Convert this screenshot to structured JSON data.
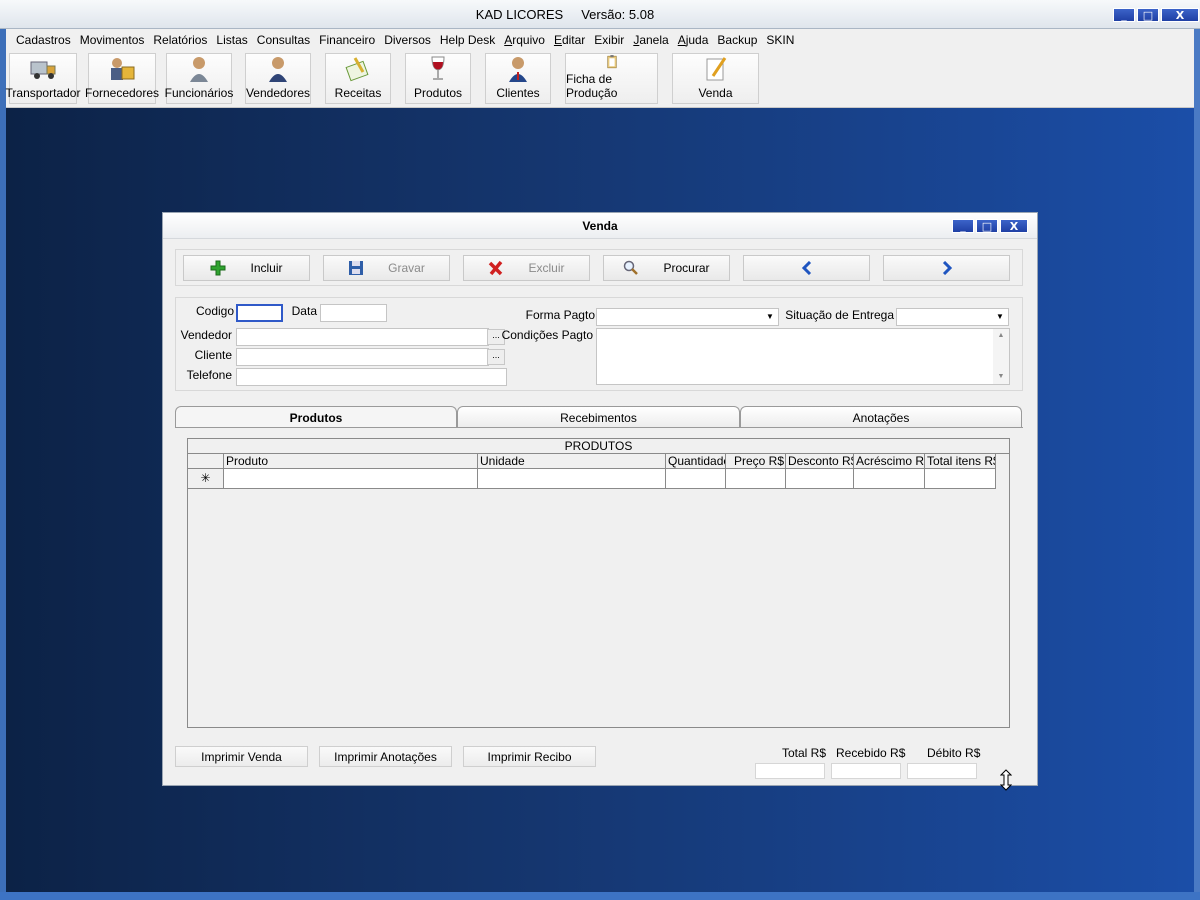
{
  "app": {
    "title": "KAD LICORES",
    "version": "Versão: 5.08",
    "window_controls": [
      "_",
      "□",
      "X"
    ]
  },
  "menu": [
    {
      "label": "Cadastros"
    },
    {
      "label": "Movimentos"
    },
    {
      "label": "Relatórios"
    },
    {
      "label": "Listas"
    },
    {
      "label": "Consultas"
    },
    {
      "label": "Financeiro"
    },
    {
      "label": "Diversos"
    },
    {
      "label": "Help Desk"
    },
    {
      "label": "Arquivo"
    },
    {
      "label": "Editar"
    },
    {
      "label": "Exibir"
    },
    {
      "label": "Janela"
    },
    {
      "label": "Ajuda"
    },
    {
      "label": "Backup"
    },
    {
      "label": "SKIN"
    }
  ],
  "toolbar": [
    {
      "label": "Transportador",
      "icon": "truck-icon"
    },
    {
      "label": "Fornecedores",
      "icon": "suppliers-icon"
    },
    {
      "label": "Funcionários",
      "icon": "employee-icon"
    },
    {
      "label": "Vendedores",
      "icon": "seller-icon"
    },
    {
      "label": "Receitas",
      "icon": "recipe-icon"
    },
    {
      "label": "Produtos",
      "icon": "wine-glass-icon"
    },
    {
      "label": "Clientes",
      "icon": "client-icon"
    },
    {
      "label": "Ficha de Produção",
      "icon": "clipboard-icon"
    },
    {
      "label": "Venda",
      "icon": "notepad-pencil-icon"
    }
  ],
  "venda": {
    "title": "Venda",
    "actions": {
      "incluir": "Incluir",
      "gravar": "Gravar",
      "excluir": "Excluir",
      "procurar": "Procurar",
      "prev": "‹",
      "next": "›"
    },
    "form": {
      "codigo_label": "Codigo",
      "codigo_value": "",
      "data_label": "Data",
      "data_value": "",
      "vendedor_label": "Vendedor",
      "cliente_label": "Cliente",
      "telefone_label": "Telefone",
      "forma_pagto_label": "Forma Pagto",
      "forma_pagto_value": "",
      "situacao_label": "Situação de Entrega",
      "situacao_value": "",
      "condicoes_label": "Condições Pagto",
      "ellipsis": "..."
    },
    "tabs": [
      {
        "label": "Produtos",
        "active": true
      },
      {
        "label": "Recebimentos",
        "active": false
      },
      {
        "label": "Anotações",
        "active": false
      }
    ],
    "grid": {
      "caption": "PRODUTOS",
      "columns": [
        "Produto",
        "Unidade",
        "Quantidade",
        "Preço R$",
        "Desconto R$",
        "Acréscimo R$",
        "Total itens R$"
      ],
      "new_row_marker": "✳",
      "rows": []
    },
    "print_buttons": {
      "venda": "Imprimir Venda",
      "anotacoes": "Imprimir Anotações",
      "recibo": "Imprimir Recibo"
    },
    "totals": {
      "total_label": "Total R$",
      "total_value": "",
      "recebido_label": "Recebido R$",
      "recebido_value": "",
      "debito_label": "Débito R$",
      "debito_value": ""
    }
  }
}
